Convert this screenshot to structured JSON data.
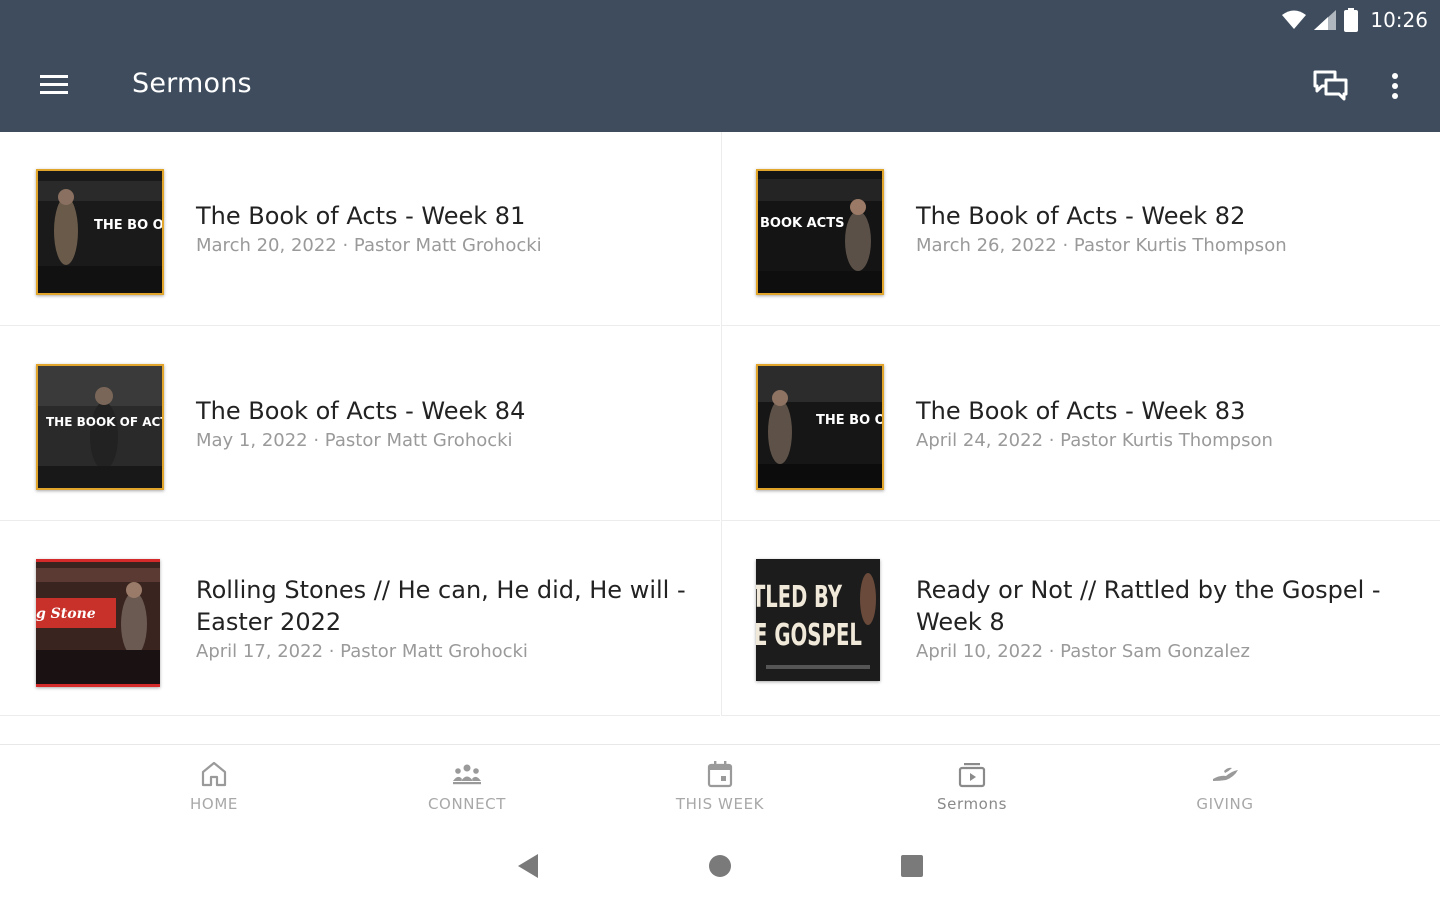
{
  "status": {
    "time": "10:26"
  },
  "app_bar": {
    "title": "Sermons"
  },
  "sermons": [
    {
      "title": "The Book of Acts - Week 81",
      "meta": "March 20, 2022 · Pastor Matt Grohocki"
    },
    {
      "title": "The Book of Acts - Week 82",
      "meta": "March 26, 2022 · Pastor Kurtis Thompson"
    },
    {
      "title": "The Book of Acts - Week 84",
      "meta": "May 1, 2022 · Pastor Matt Grohocki"
    },
    {
      "title": "The Book of Acts - Week 83",
      "meta": "April 24, 2022 · Pastor Kurtis Thompson"
    },
    {
      "title": "Rolling Stones // He can, He did, He will - Easter 2022",
      "meta": "April 17, 2022 · Pastor Matt Grohocki"
    },
    {
      "title": "Ready or Not // Rattled by the Gospel - Week 8",
      "meta": "April 10, 2022 · Pastor Sam Gonzalez"
    }
  ],
  "thumbs": {
    "acts_a": "THE BO OF AC",
    "acts_b": "BOOK ACTS",
    "acts_c": "THE BOOK OF ACTS",
    "acts_d": "THE BO OF AC",
    "rolling": "g Stone",
    "rattled_1": "TLED BY",
    "rattled_2": "E GOSPEL"
  },
  "bottom_nav": [
    {
      "label": "HOME",
      "icon": "home-icon"
    },
    {
      "label": "CONNECT",
      "icon": "people-icon"
    },
    {
      "label": "THIS WEEK",
      "icon": "calendar-icon"
    },
    {
      "label": "Sermons",
      "icon": "media-icon"
    },
    {
      "label": "GIVING",
      "icon": "giving-icon"
    }
  ],
  "colors": {
    "app_bar": "#3e4c5e",
    "thumb_border": "#e0a52a",
    "title_text": "#222222",
    "meta_text": "#9a9a9a"
  }
}
